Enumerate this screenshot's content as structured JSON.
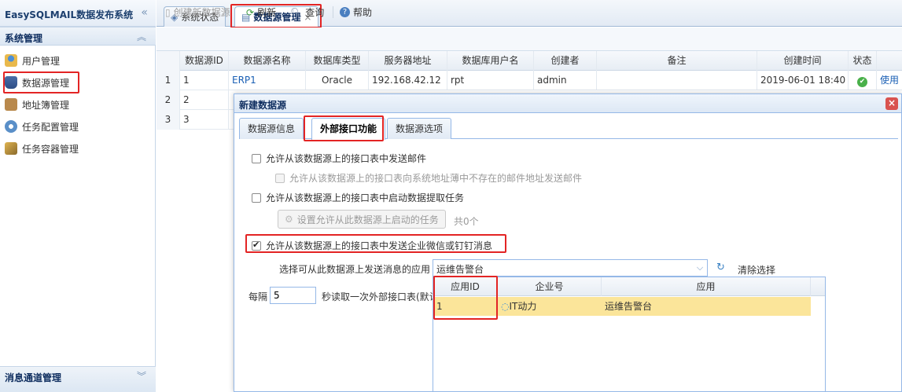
{
  "app": {
    "title": "EasySQLMAIL数据发布系统",
    "collapse_glyph": "«"
  },
  "sidebar": {
    "section_title": "系统管理",
    "items": [
      {
        "label": "用户管理",
        "icon": "users-icon"
      },
      {
        "label": "数据源管理",
        "icon": "database-icon"
      },
      {
        "label": "地址簿管理",
        "icon": "address-book-icon"
      },
      {
        "label": "任务配置管理",
        "icon": "gear-icon"
      },
      {
        "label": "任务容器管理",
        "icon": "container-icon"
      }
    ],
    "bottom_section": "消息通道管理"
  },
  "tabs": [
    {
      "label": "系统状态"
    },
    {
      "label": "数据源管理",
      "close": "×"
    }
  ],
  "toolbar": {
    "create": "创建新数据源",
    "refresh": "刷新",
    "query": "查询",
    "help": "帮助"
  },
  "grid": {
    "headers": [
      "数据源ID",
      "数据源名称",
      "数据库类型",
      "服务器地址",
      "数据库用户名",
      "创建者",
      "备注",
      "创建时间",
      "状态"
    ],
    "rows": [
      {
        "rownum": "1",
        "id": "1",
        "name": "ERP1",
        "db_type": "Oracle",
        "server": "192.168.42.12",
        "db_user": "rpt",
        "creator": "admin",
        "note": "",
        "created": "2019-06-01 18:40",
        "status": "ok",
        "action": "使用"
      },
      {
        "rownum": "2",
        "id": "2"
      },
      {
        "rownum": "3",
        "id": "3"
      }
    ]
  },
  "modal": {
    "title": "新建数据源",
    "close": "×",
    "tabs": [
      "数据源信息",
      "外部接口功能",
      "数据源选项"
    ],
    "active_tab": 1,
    "options": {
      "send_mail": "允许从该数据源上的接口表中发送邮件",
      "send_mail_unknown": "允许从该数据源上的接口表向系统地址薄中不存在的邮件地址发送邮件",
      "start_task": "允许从该数据源上的接口表中启动数据提取任务",
      "set_tasks_button": "设置允许从此数据源上启动的任务",
      "task_count": "共0个",
      "send_wechat": "允许从该数据源上的接口表中发送企业微信或钉钉消息",
      "send_wechat_checked": true
    },
    "app_select_label": "选择可从此数据源上发送消息的应用",
    "app_select_value": "运维告警台",
    "clear_selection": "清除选择",
    "dropdown": {
      "headers": [
        "应用ID",
        "企业号",
        "应用"
      ],
      "rows": [
        {
          "id": "1",
          "corp": "IT动力",
          "app": "运维告警台"
        }
      ]
    },
    "interval_prefix": "每隔",
    "interval_value": "5",
    "interval_suffix": "秒读取一次外部接口表(默认"
  }
}
